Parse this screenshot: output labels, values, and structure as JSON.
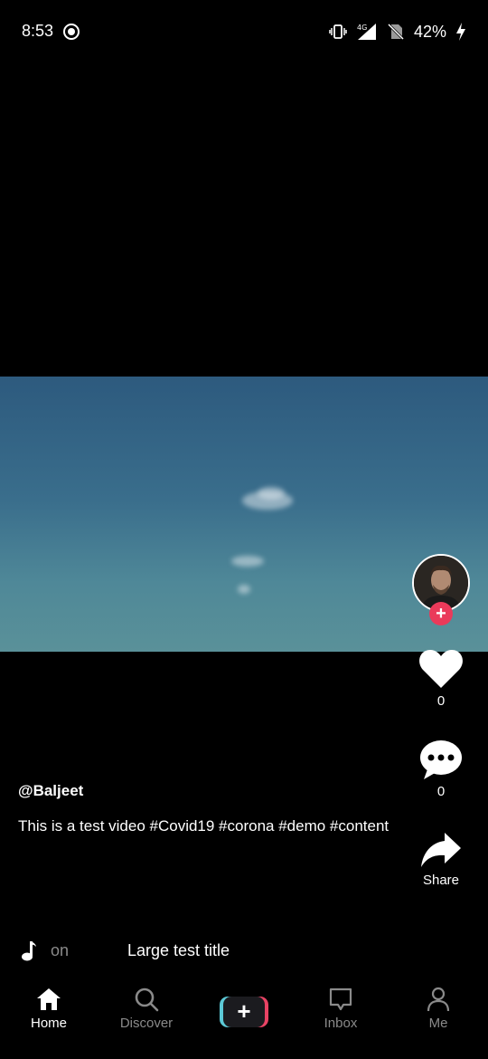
{
  "status_bar": {
    "time": "8:53",
    "battery": "42%",
    "network": "4G"
  },
  "video": {
    "author": "@Baljeet",
    "description": "This is a test video #Covid19 #corona #demo #content"
  },
  "actions": {
    "likes": "0",
    "comments": "0",
    "share_label": "Share"
  },
  "music": {
    "scroll_fragment": "on",
    "title": "Large test title"
  },
  "nav": {
    "home": "Home",
    "discover": "Discover",
    "create": "+",
    "inbox": "Inbox",
    "me": "Me"
  },
  "colors": {
    "follow_badge": "#ea3a5a",
    "create_left": "#5cc9d6",
    "create_right": "#e94364",
    "nav_inactive": "#8a8a8a"
  }
}
